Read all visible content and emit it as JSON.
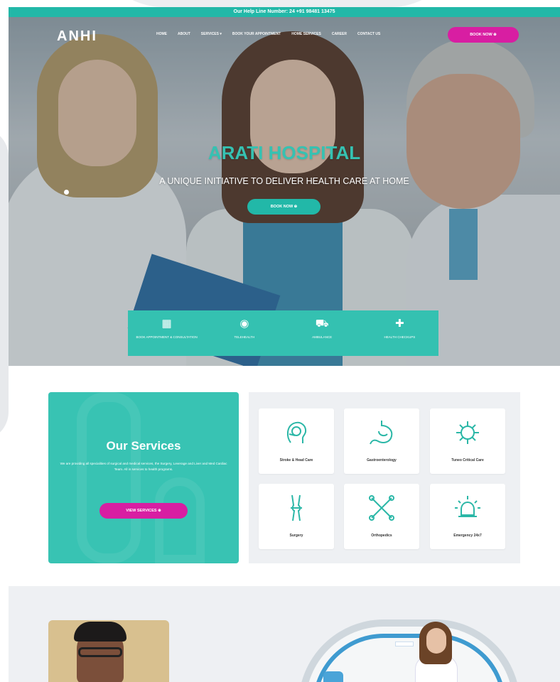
{
  "helpbar": {
    "text": "Our Help Line Number: 24 +91 98481 13475"
  },
  "header": {
    "logo": "ANHI",
    "nav": [
      "HOME",
      "ABOUT",
      "SERVICES ▾",
      "BOOK YOUR APPOINTMENT",
      "HOME SERVICES",
      "CAREER",
      "CONTACT US"
    ],
    "appointment_button": "BOOK NOW ⊕"
  },
  "hero": {
    "title": "ARATI HOSPITAL",
    "subtitle": "A UNIQUE INITIATIVE TO DELIVER HEALTH CARE AT HOME",
    "button": "BOOK NOW ⊕",
    "features": [
      {
        "icon": "calendar-icon",
        "glyph": "▦",
        "label": "BOOK APPOINTMENT & CONSULTATION"
      },
      {
        "icon": "chat-icon",
        "glyph": "◉",
        "label": "TELEHEALTH"
      },
      {
        "icon": "ambulance-icon",
        "glyph": "⛟",
        "label": "AMBULANCE"
      },
      {
        "icon": "home-care-icon",
        "glyph": "✚",
        "label": "HEALTH CHECKUPS"
      }
    ]
  },
  "services": {
    "title": "Our Services",
    "description": "We are providing all specialities of surgical and medical services, the Surgery, Leverage and Liver and Med Cardiac Team. All in services to health programs.",
    "button": "VIEW SERVICES ⊕",
    "tiles": [
      {
        "icon": "head-injury-icon",
        "label": "Stroke & Head Care"
      },
      {
        "icon": "stomach-icon",
        "label": "Gastroenterology"
      },
      {
        "icon": "virus-icon",
        "label": "Tuneo Critical Care"
      },
      {
        "icon": "knee-joint-icon",
        "label": "Surgery"
      },
      {
        "icon": "bone-icon",
        "label": "Orthopedics"
      },
      {
        "icon": "emergency-light-icon",
        "label": "Emergency 24x7"
      }
    ]
  },
  "colors": {
    "teal": "#22b8a8",
    "magenta": "#d81ea2",
    "card_teal": "#38c3b3"
  }
}
